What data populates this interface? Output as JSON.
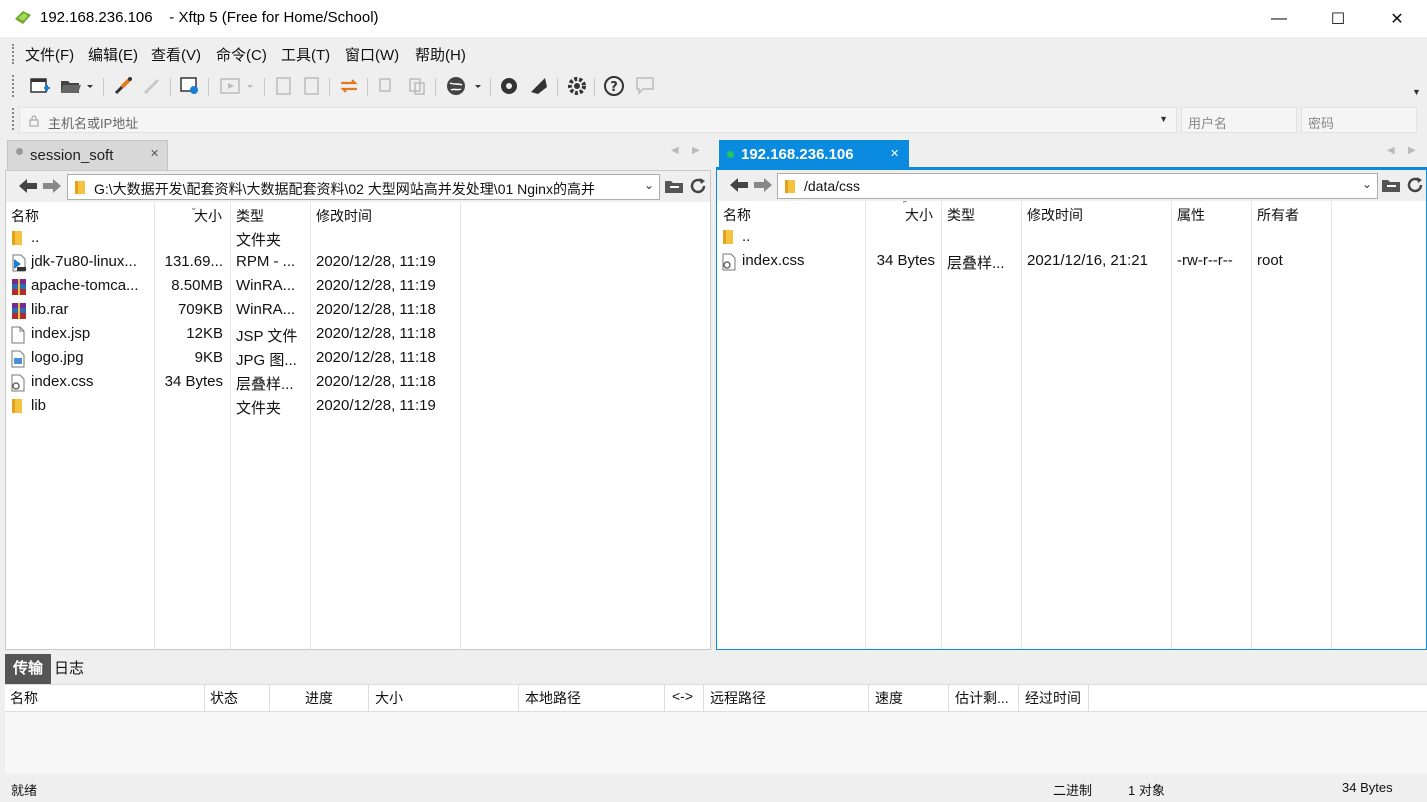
{
  "window": {
    "title": "192.168.236.106    - Xftp 5 (Free for Home/School)",
    "minimize": "—",
    "maximize": "☐",
    "close": "✕"
  },
  "menu": [
    "文件(F)",
    "编辑(E)",
    "查看(V)",
    "命令(C)",
    "工具(T)",
    "窗口(W)",
    "帮助(H)"
  ],
  "address": {
    "host_placeholder": "主机名或IP地址",
    "user_placeholder": "用户名",
    "password_placeholder": "密码"
  },
  "local": {
    "tab_label": "session_soft",
    "path": "G:\\大数据开发\\配套资料\\大数据配套资料\\02 大型网站高并发处理\\01 Nginx的高并",
    "columns": [
      "名称",
      "大小",
      "类型",
      "修改时间"
    ],
    "files": [
      {
        "name": "..",
        "size": "",
        "type": "文件夹",
        "modified": "",
        "icon": "folder-icon"
      },
      {
        "name": "jdk-7u80-linux...",
        "size": "131.69...",
        "type": "RPM - ...",
        "modified": "2020/12/28, 11:19",
        "icon": "rpm-file-icon"
      },
      {
        "name": "apache-tomca...",
        "size": "8.50MB",
        "type": "WinRA...",
        "modified": "2020/12/28, 11:19",
        "icon": "archive-icon"
      },
      {
        "name": "lib.rar",
        "size": "709KB",
        "type": "WinRA...",
        "modified": "2020/12/28, 11:18",
        "icon": "archive-icon"
      },
      {
        "name": "index.jsp",
        "size": "12KB",
        "type": "JSP 文件",
        "modified": "2020/12/28, 11:18",
        "icon": "file-icon"
      },
      {
        "name": "logo.jpg",
        "size": "9KB",
        "type": "JPG 图...",
        "modified": "2020/12/28, 11:18",
        "icon": "image-file-icon"
      },
      {
        "name": "index.css",
        "size": "34 Bytes",
        "type": "层叠样...",
        "modified": "2020/12/28, 11:18",
        "icon": "css-file-icon"
      },
      {
        "name": "lib",
        "size": "",
        "type": "文件夹",
        "modified": "2020/12/28, 11:19",
        "icon": "folder-icon"
      }
    ]
  },
  "remote": {
    "tab_label": "192.168.236.106",
    "path": "/data/css",
    "columns": [
      "名称",
      "大小",
      "类型",
      "修改时间",
      "属性",
      "所有者"
    ],
    "files": [
      {
        "name": "..",
        "size": "",
        "type": "",
        "modified": "",
        "attr": "",
        "owner": "",
        "icon": "folder-icon"
      },
      {
        "name": "index.css",
        "size": "34 Bytes",
        "type": "层叠样...",
        "modified": "2021/12/16, 21:21",
        "attr": "-rw-r--r--",
        "owner": "root",
        "icon": "css-file-icon"
      }
    ]
  },
  "bottom": {
    "tabs": [
      "传输",
      "日志"
    ],
    "columns": [
      "名称",
      "状态",
      "进度",
      "大小",
      "本地路径",
      "<->",
      "远程路径",
      "速度",
      "估计剩...",
      "经过时间"
    ]
  },
  "status": {
    "ready": "就绪",
    "mode": "二进制",
    "objects": "1 对象",
    "size": "34 Bytes"
  },
  "colors": {
    "accent": "#0a8be0",
    "connected": "#22c55e"
  }
}
